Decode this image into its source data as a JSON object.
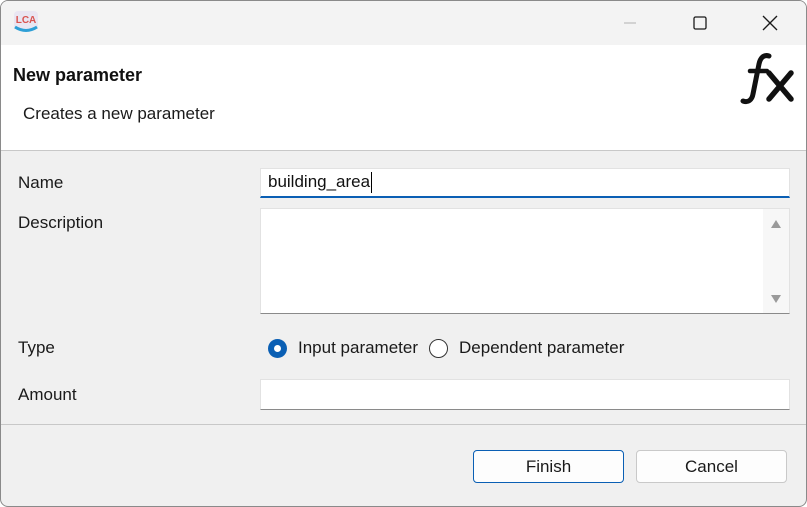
{
  "window": {
    "app_icon": "openlca-logo-icon",
    "app_logo_text": "LCA",
    "controls": [
      "minimize-icon",
      "maximize-icon",
      "close-icon"
    ]
  },
  "banner": {
    "title": "New parameter",
    "subtitle": "Creates a new parameter",
    "icon": "fx-icon"
  },
  "form": {
    "name_label": "Name",
    "name_value": "building_area",
    "description_label": "Description",
    "description_value": "",
    "type_label": "Type",
    "type_options": [
      {
        "label": "Input parameter",
        "selected": true
      },
      {
        "label": "Dependent parameter",
        "selected": false
      }
    ],
    "amount_label": "Amount",
    "amount_value": ""
  },
  "buttons": {
    "finish": "Finish",
    "cancel": "Cancel"
  },
  "colors": {
    "accent": "#0a5fb4",
    "dialog_bg": "#f0f0f0",
    "banner_bg": "#ffffff"
  }
}
